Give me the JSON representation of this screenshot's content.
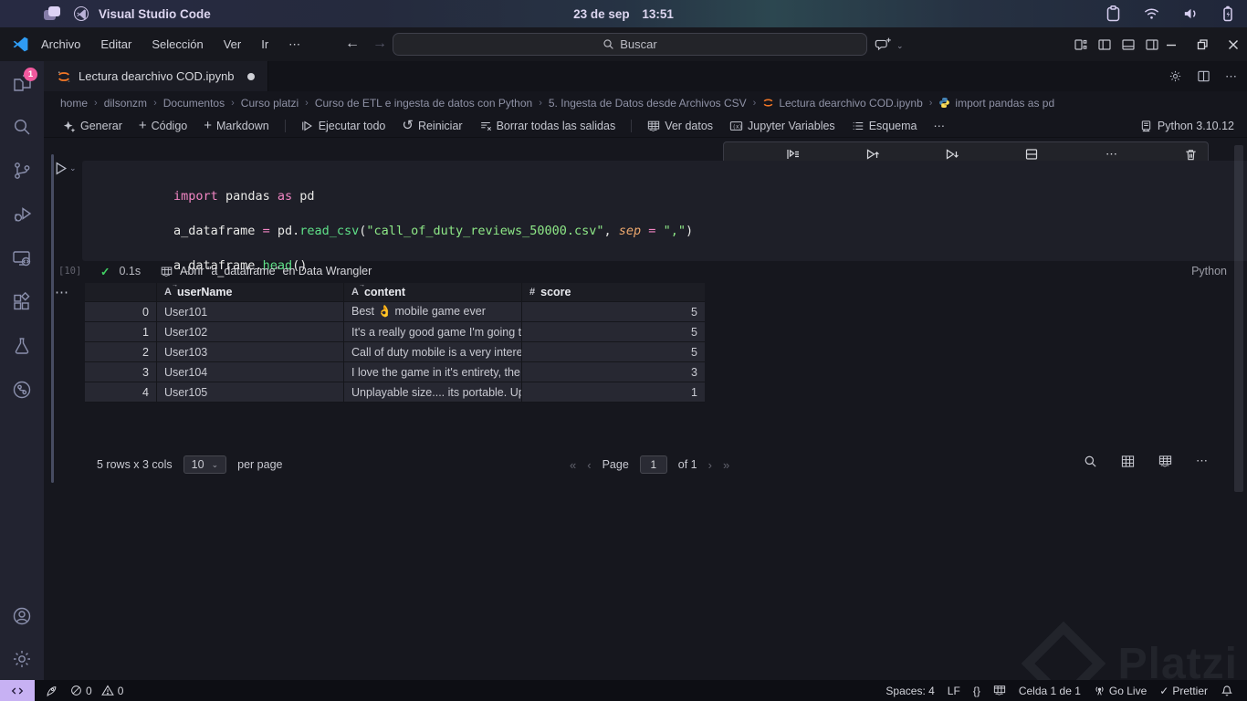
{
  "system_bar": {
    "app_title": "Visual Studio Code",
    "clock_date": "23 de sep",
    "clock_time": "13:51"
  },
  "title_bar": {
    "menus": [
      "Archivo",
      "Editar",
      "Selección",
      "Ver",
      "Ir",
      "⋯"
    ],
    "search_placeholder": "Buscar"
  },
  "tab": {
    "title": "Lectura dearchivo COD.ipynb"
  },
  "breadcrumbs": {
    "items": [
      "home",
      "dilsonzm",
      "Documentos",
      "Curso platzi",
      "Curso de ETL e ingesta de datos con Python",
      "5. Ingesta de Datos desde Archivos CSV",
      "Lectura dearchivo COD.ipynb",
      "import pandas as pd"
    ]
  },
  "toolbar": {
    "generate": "Generar",
    "code": "Código",
    "markdown": "Markdown",
    "run_all": "Ejecutar todo",
    "restart": "Reiniciar",
    "clear_outputs": "Borrar todas las salidas",
    "view_data": "Ver datos",
    "variables": "Jupyter Variables",
    "outline": "Esquema",
    "more": "⋯",
    "kernel": "Python 3.10.12"
  },
  "cell": {
    "execution_count": "[10]",
    "duration": "0.1s",
    "wrangler_link": "Abrir \"a_dataframe\" en Data Wrangler",
    "language": "Python",
    "code": {
      "line1": [
        {
          "t": "import"
        },
        {
          "t": " pandas "
        },
        {
          "t": "as"
        },
        {
          "t": " pd"
        }
      ],
      "line3": [
        {
          "t": "a_dataframe "
        },
        {
          "t": "="
        },
        {
          "t": " pd."
        },
        {
          "t": "read_csv"
        },
        {
          "t": "("
        },
        {
          "t": "\"call_of_duty_reviews_50000.csv\""
        },
        {
          "t": ", "
        },
        {
          "t": "sep"
        },
        {
          "t": " "
        },
        {
          "t": "="
        },
        {
          "t": " "
        },
        {
          "t": "\",\""
        },
        {
          "t": ")"
        }
      ],
      "line5": [
        {
          "t": "a_dataframe."
        },
        {
          "t": "head"
        },
        {
          "t": "()"
        }
      ]
    }
  },
  "output": {
    "more_label": "⋯",
    "table": {
      "headers": [
        {
          "type": "string",
          "label": "userName"
        },
        {
          "type": "string",
          "label": "content"
        },
        {
          "type": "number",
          "label": "score"
        }
      ],
      "rows": [
        {
          "index": "0",
          "userName": "User101",
          "content": "Best 👌 mobile game ever",
          "score": "5"
        },
        {
          "index": "1",
          "userName": "User102",
          "content": "It's a really good game I'm going to",
          "score": "5"
        },
        {
          "index": "2",
          "userName": "User103",
          "content": "Call of duty mobile is a very interesti",
          "score": "5"
        },
        {
          "index": "3",
          "userName": "User104",
          "content": "I love the game in it's entirety, the or",
          "score": "3"
        },
        {
          "index": "4",
          "userName": "User105",
          "content": "Unplayable size.... its portable. Updat",
          "score": "1"
        }
      ]
    },
    "pagination": {
      "summary": "5 rows x 3 cols",
      "page_size": "10",
      "per_page": "per page",
      "page_label": "Page",
      "page_value": "1",
      "of_label": "of 1"
    }
  },
  "status_bar": {
    "errors": "0",
    "warnings": "0",
    "spaces": "Spaces: 4",
    "eol": "LF",
    "braces": "{}",
    "cell_indicator": "Celda 1 de 1",
    "go_live": "Go Live",
    "prettier": "Prettier"
  },
  "watermark": {
    "text": "Platzi"
  },
  "icons": {
    "system_tray": [
      "clipboard",
      "wifi",
      "volume",
      "battery-charging"
    ],
    "activity_bar": [
      "explorer",
      "search",
      "source-control",
      "run-and-debug",
      "remote-explorer",
      "extensions",
      "testing",
      "live-share",
      "account",
      "settings"
    ],
    "tab": "jupyter",
    "cell_toolbar": [
      "execute-above",
      "run-cells-above",
      "run-cell-and-below",
      "split-cell",
      "more",
      "delete-cell"
    ]
  },
  "colors": {
    "keyword_pink": "#f286c4",
    "function_green": "#5fe088",
    "string_green": "#8ee887",
    "param_orange": "#efa96e",
    "jupyter_orange": "#f37726",
    "badge_pink": "#f2599e",
    "remote_chip": "#c7b1f3",
    "check_green": "#41cf63"
  }
}
